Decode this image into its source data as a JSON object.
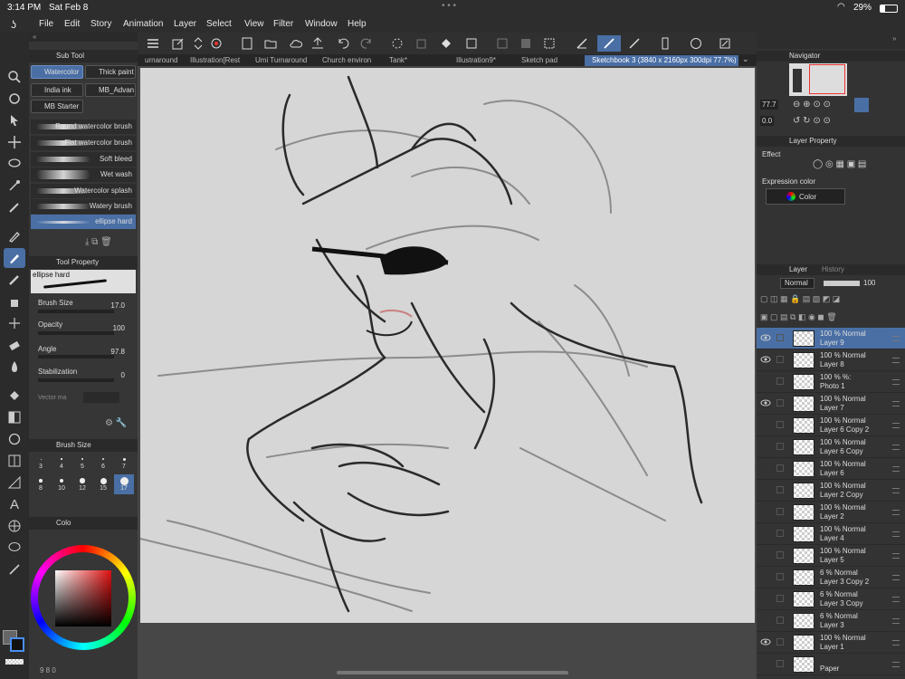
{
  "status": {
    "time": "3:14 PM",
    "date": "Sat Feb 8",
    "battery": "29%"
  },
  "menu": {
    "items": [
      "File",
      "Edit",
      "Story",
      "Animation",
      "Layer",
      "Select",
      "View",
      "Filter",
      "Window",
      "Help"
    ]
  },
  "subtool": {
    "header": "Sub Tool",
    "groups": [
      "Watercolor",
      "Thick paint",
      "India ink",
      "MB_Advan",
      "MB Starter"
    ],
    "brushes": [
      "Round watercolor brush",
      "Flat watercolor brush",
      "Soft bleed",
      "Wet wash",
      "Watercolor splash",
      "Watery brush",
      "ellipse hard"
    ]
  },
  "toolprop": {
    "header": "Tool Property",
    "brush_name": "ellipse hard",
    "brush_size_label": "Brush Size",
    "brush_size": "17.0",
    "opacity_label": "Opacity",
    "opacity": "100",
    "angle_label": "Angle",
    "angle": "97.8",
    "stabilization_label": "Stabilization",
    "stabilization": "0",
    "vector_label": "Vector ma"
  },
  "brushsize": {
    "header": "Brush Size",
    "sizes": [
      "3",
      "4",
      "5",
      "6",
      "7",
      "8",
      "10",
      "12",
      "15",
      "17"
    ]
  },
  "color": {
    "header": "Colo",
    "foreground": "#111111",
    "background": "#ffffff",
    "indicator": "9 8 0"
  },
  "tabs": [
    "urnaround",
    "Illustration[Rest",
    "Umi Turnaround",
    "Church environ",
    "Tank*",
    "Illustration9*",
    "Sketch pad",
    "Sketchbook 3 (3840 x 2160px 300dpi 77.7%)"
  ],
  "navigator": {
    "header": "Navigator",
    "zoom": "77.7",
    "rotation": "0.0"
  },
  "layerprop": {
    "header": "Layer Property",
    "effect_label": "Effect",
    "expression_label": "Expression color",
    "expression_value": "Color"
  },
  "layerpanel": {
    "header": "Layer",
    "history": "History",
    "blend": "Normal",
    "opacity": "100"
  },
  "layers": [
    {
      "pct": "100 %  Normal",
      "name": "Layer 9",
      "visible": true,
      "selected": true
    },
    {
      "pct": "100 %  Normal",
      "name": "Layer 8",
      "visible": true,
      "selected": false
    },
    {
      "pct": "100 %  %:",
      "name": "Photo 1",
      "visible": false,
      "selected": false
    },
    {
      "pct": "100 %  Normal",
      "name": "Layer 7",
      "visible": true,
      "selected": false
    },
    {
      "pct": "100 %  Normal",
      "name": "Layer 6 Copy 2",
      "visible": false,
      "selected": false
    },
    {
      "pct": "100 %  Normal",
      "name": "Layer 6 Copy",
      "visible": false,
      "selected": false
    },
    {
      "pct": "100 %  Normal",
      "name": "Layer 6",
      "visible": false,
      "selected": false
    },
    {
      "pct": "100 %  Normal",
      "name": "Layer 2 Copy",
      "visible": false,
      "selected": false
    },
    {
      "pct": "100 %  Normal",
      "name": "Layer 2",
      "visible": false,
      "selected": false
    },
    {
      "pct": "100 %  Normal",
      "name": "Layer 4",
      "visible": false,
      "selected": false
    },
    {
      "pct": "100 %  Normal",
      "name": "Layer 5",
      "visible": false,
      "selected": false
    },
    {
      "pct": "6 %  Normal",
      "name": "Layer 3 Copy 2",
      "visible": false,
      "selected": false
    },
    {
      "pct": "6 %  Normal",
      "name": "Layer 3 Copy",
      "visible": false,
      "selected": false
    },
    {
      "pct": "6 %  Normal",
      "name": "Layer 3",
      "visible": false,
      "selected": false
    },
    {
      "pct": "100 %  Normal",
      "name": "Layer 1",
      "visible": true,
      "selected": false
    },
    {
      "pct": "",
      "name": "Paper",
      "visible": false,
      "selected": false
    }
  ]
}
